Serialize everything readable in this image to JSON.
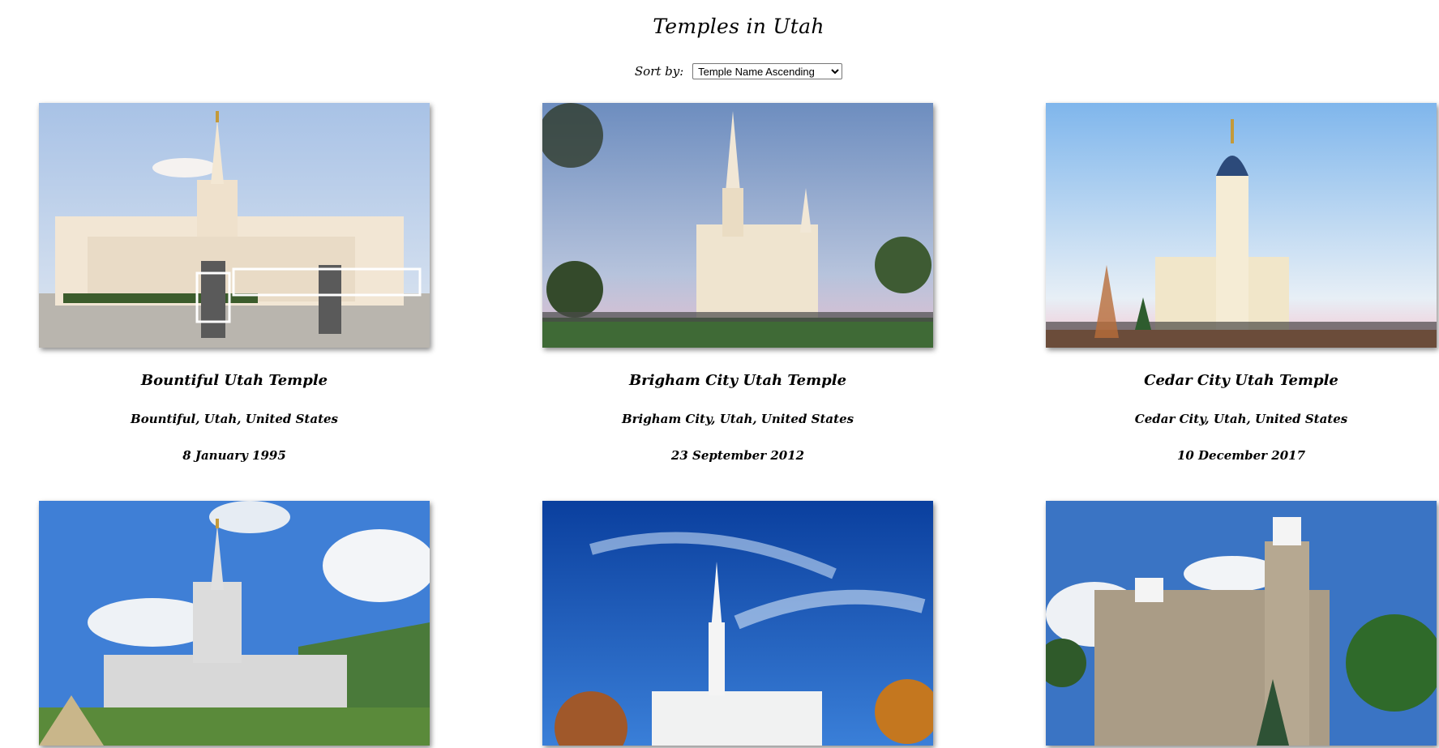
{
  "page": {
    "title": "Temples in Utah"
  },
  "sort": {
    "label": "Sort by:",
    "selected": "Temple Name Ascending"
  },
  "temples": [
    {
      "name": "Bountiful Utah Temple",
      "location": "Bountiful, Utah, United States",
      "dedicated": "8 January 1995"
    },
    {
      "name": "Brigham City Utah Temple",
      "location": "Brigham City, Utah, United States",
      "dedicated": "23 September 2012"
    },
    {
      "name": "Cedar City Utah Temple",
      "location": "Cedar City, Utah, United States",
      "dedicated": "10 December 2017"
    },
    {
      "name": "",
      "location": "",
      "dedicated": ""
    },
    {
      "name": "",
      "location": "",
      "dedicated": ""
    },
    {
      "name": "",
      "location": "",
      "dedicated": ""
    }
  ]
}
